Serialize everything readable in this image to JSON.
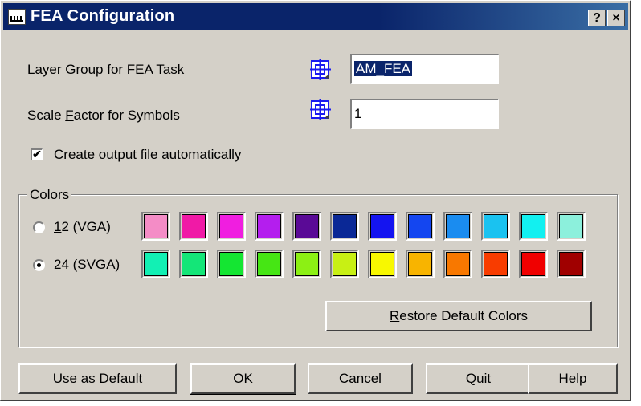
{
  "window": {
    "title": "FEA Configuration",
    "help_btn": "?",
    "close_btn": "×"
  },
  "fields": [
    {
      "label_pre": "",
      "accel": "L",
      "label_post": "ayer Group for FEA Task",
      "value": "AM_FEA",
      "selected": true
    },
    {
      "label_pre": "Scale ",
      "accel": "F",
      "label_post": "actor for Symbols",
      "value": "1",
      "selected": false
    }
  ],
  "checkbox": {
    "accel": "C",
    "label_post": "reate output file automatically",
    "checked": true,
    "mark": "✔"
  },
  "colors": {
    "group_label": "Colors",
    "options": [
      {
        "accel": "1",
        "label_post": "2 (VGA)",
        "selected": false,
        "swatches": [
          "#f48cc6",
          "#f01aa6",
          "#f01ee0",
          "#b41eee",
          "#5a0a96",
          "#0a2896",
          "#1414f0",
          "#1446f0",
          "#1a8cf0",
          "#1ac2f0",
          "#12f0f0",
          "#8cf0dc"
        ]
      },
      {
        "accel": "2",
        "label_post": "4 (SVGA)",
        "selected": true,
        "swatches": [
          "#12f0b4",
          "#14e678",
          "#14e632",
          "#46e614",
          "#8cf014",
          "#c8f014",
          "#f8f800",
          "#f8b400",
          "#f87800",
          "#f83c00",
          "#f00000",
          "#a00000"
        ]
      }
    ],
    "restore_pre": "",
    "restore_accel": "R",
    "restore_post": "estore Default Colors"
  },
  "buttons": [
    {
      "name": "use-as-default-button",
      "pre": "",
      "accel": "U",
      "post": "se as Default"
    },
    {
      "name": "ok-button",
      "pre": "OK",
      "accel": "",
      "post": ""
    },
    {
      "name": "cancel-button",
      "pre": "Cancel",
      "accel": "",
      "post": ""
    },
    {
      "name": "quit-button",
      "pre": "",
      "accel": "Q",
      "post": "uit"
    },
    {
      "name": "help-button",
      "pre": "",
      "accel": "H",
      "post": "elp"
    }
  ]
}
